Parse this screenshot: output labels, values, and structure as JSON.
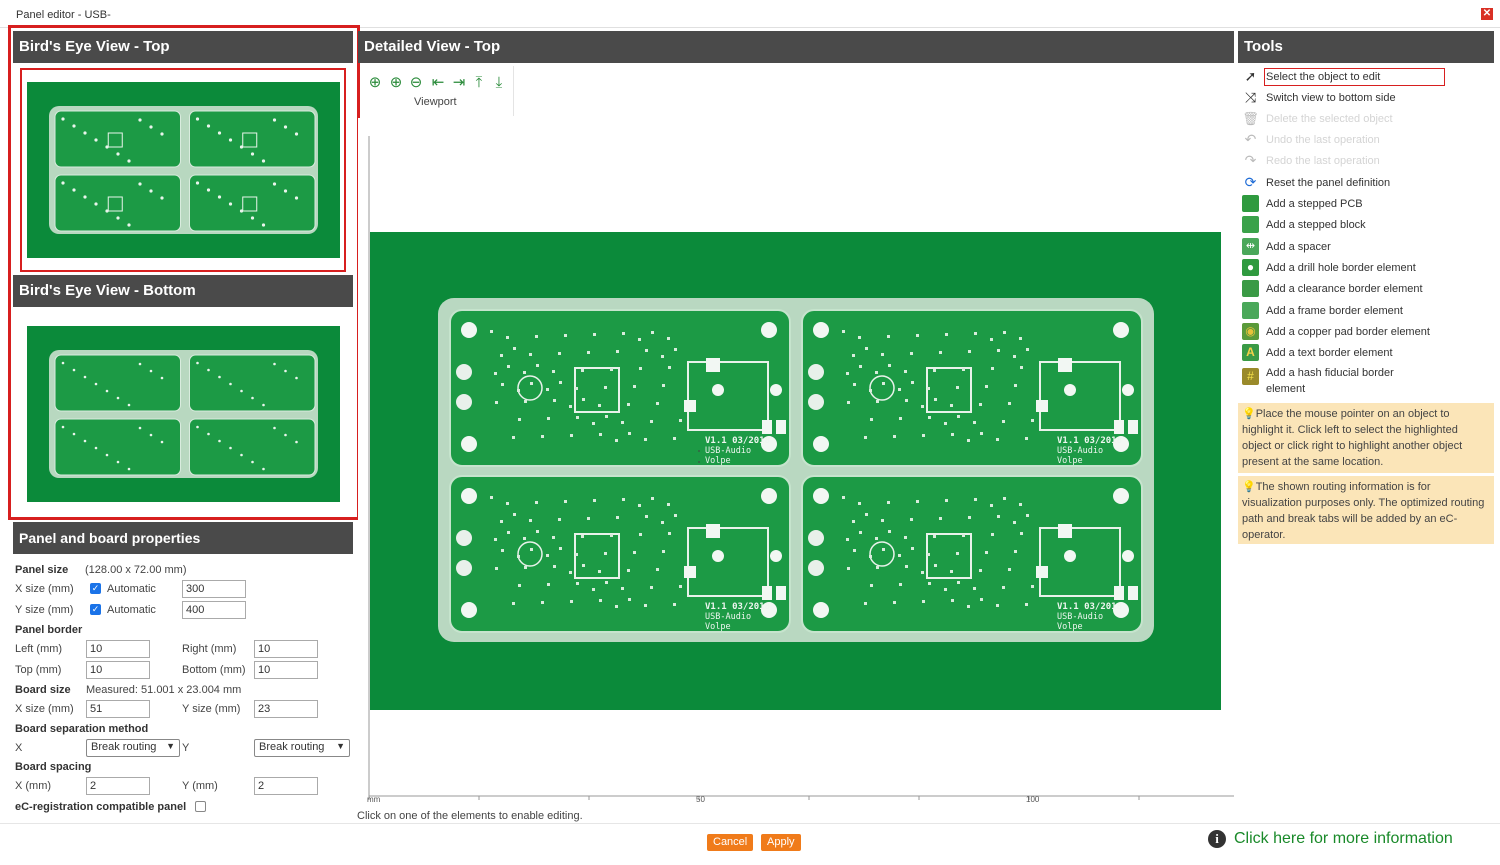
{
  "window": {
    "title": "Panel editor - USB-",
    "close_glyph": "✕"
  },
  "birds_eye_top": {
    "title": "Bird's Eye View - Top"
  },
  "birds_eye_bottom": {
    "title": "Bird's Eye View - Bottom"
  },
  "detailed": {
    "title": "Detailed View - Top",
    "viewport_label": "Viewport",
    "scroll_up_glyph": "▲",
    "axis": {
      "unit": "mm",
      "ticks": [
        "50",
        "100"
      ]
    },
    "status": "Click on one of the elements to enable editing.",
    "board_label": {
      "version": "V1.1 03/2018",
      "name": "USB-Audio",
      "author": "Volpe"
    }
  },
  "properties": {
    "title": "Panel and board properties",
    "panel_size": {
      "label": "Panel size",
      "measured": "(128.00 x 72.00 mm)"
    },
    "x_size": {
      "label": "X size (mm)",
      "auto_label": "Automatic",
      "value": "300"
    },
    "y_size": {
      "label": "Y size (mm)",
      "auto_label": "Automatic",
      "value": "400"
    },
    "panel_border": {
      "label": "Panel border",
      "left_label": "Left (mm)",
      "left": "10",
      "right_label": "Right (mm)",
      "right": "10",
      "top_label": "Top (mm)",
      "top": "10",
      "bottom_label": "Bottom (mm)",
      "bottom": "10"
    },
    "board_size": {
      "label": "Board size",
      "measured": "Measured: 51.001 x 23.004 mm",
      "x_label": "X size (mm)",
      "x": "51",
      "y_label": "Y size (mm)",
      "y": "23"
    },
    "separation": {
      "label": "Board separation method",
      "x_label": "X",
      "x_value": "Break routing",
      "y_label": "Y",
      "y_value": "Break routing"
    },
    "spacing": {
      "label": "Board spacing",
      "x_label": "X (mm)",
      "x": "2",
      "y_label": "Y (mm)",
      "y": "2"
    },
    "ec_registration": {
      "label": "eC-registration compatible panel"
    }
  },
  "tools": {
    "title": "Tools",
    "items": [
      {
        "label": "Select the object to edit",
        "icon": "cursor-icon",
        "enabled": true
      },
      {
        "label": "Switch view to bottom side",
        "icon": "switch-icon",
        "enabled": true
      },
      {
        "label": "Delete the selected object",
        "icon": "trash-icon",
        "enabled": false
      },
      {
        "label": "Undo the last operation",
        "icon": "undo-icon",
        "enabled": false
      },
      {
        "label": "Redo the last operation",
        "icon": "redo-icon",
        "enabled": false
      },
      {
        "label": "Reset the panel definition",
        "icon": "reset-icon",
        "enabled": true
      },
      {
        "label": "Add a stepped PCB",
        "icon": "stepped-pcb-icon",
        "enabled": true
      },
      {
        "label": "Add a stepped block",
        "icon": "stepped-block-icon",
        "enabled": true
      },
      {
        "label": "Add a spacer",
        "icon": "spacer-icon",
        "enabled": true
      },
      {
        "label": "Add a drill hole border element",
        "icon": "drill-hole-icon",
        "enabled": true
      },
      {
        "label": "Add a clearance border element",
        "icon": "clearance-icon",
        "enabled": true
      },
      {
        "label": "Add a frame border element",
        "icon": "frame-icon",
        "enabled": true
      },
      {
        "label": "Add a copper pad border element",
        "icon": "copper-pad-icon",
        "enabled": true
      },
      {
        "label": "Add a text border element",
        "icon": "text-icon",
        "enabled": true
      },
      {
        "label_line1": "Add a hash fiducial border",
        "label_line2": "element",
        "icon": "hash-fiducial-icon",
        "enabled": true
      }
    ],
    "note1": "Place the mouse pointer on an object to highlight it. Click left to select the highlighted object or click right to highlight another object present at the same location.",
    "note2": "The shown routing information is for visualization purposes only. The optimized routing path and break tabs will be added by an eC-operator."
  },
  "footer": {
    "cancel": "Cancel",
    "apply": "Apply",
    "more_info": "Click here for more information",
    "info_glyph": "i"
  },
  "colors": {
    "accent": "#f07b1a",
    "pcb_green": "#0b8a3a",
    "highlight_red": "#d71f1f",
    "header_bg": "#4a4a4a",
    "note_bg": "#fbe5b8"
  }
}
